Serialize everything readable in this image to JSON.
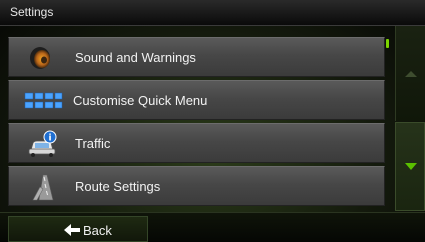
{
  "header": {
    "title": "Settings"
  },
  "menu": {
    "items": [
      {
        "label": "Sound and Warnings",
        "icon": "speaker-icon"
      },
      {
        "label": "Customise Quick Menu",
        "icon": "grid-icon"
      },
      {
        "label": "Traffic",
        "icon": "traffic-car-icon"
      },
      {
        "label": "Route Settings",
        "icon": "road-icon"
      }
    ]
  },
  "footer": {
    "back_label": "Back"
  },
  "colors": {
    "accent": "#5ac000",
    "background": "#141a0d"
  }
}
